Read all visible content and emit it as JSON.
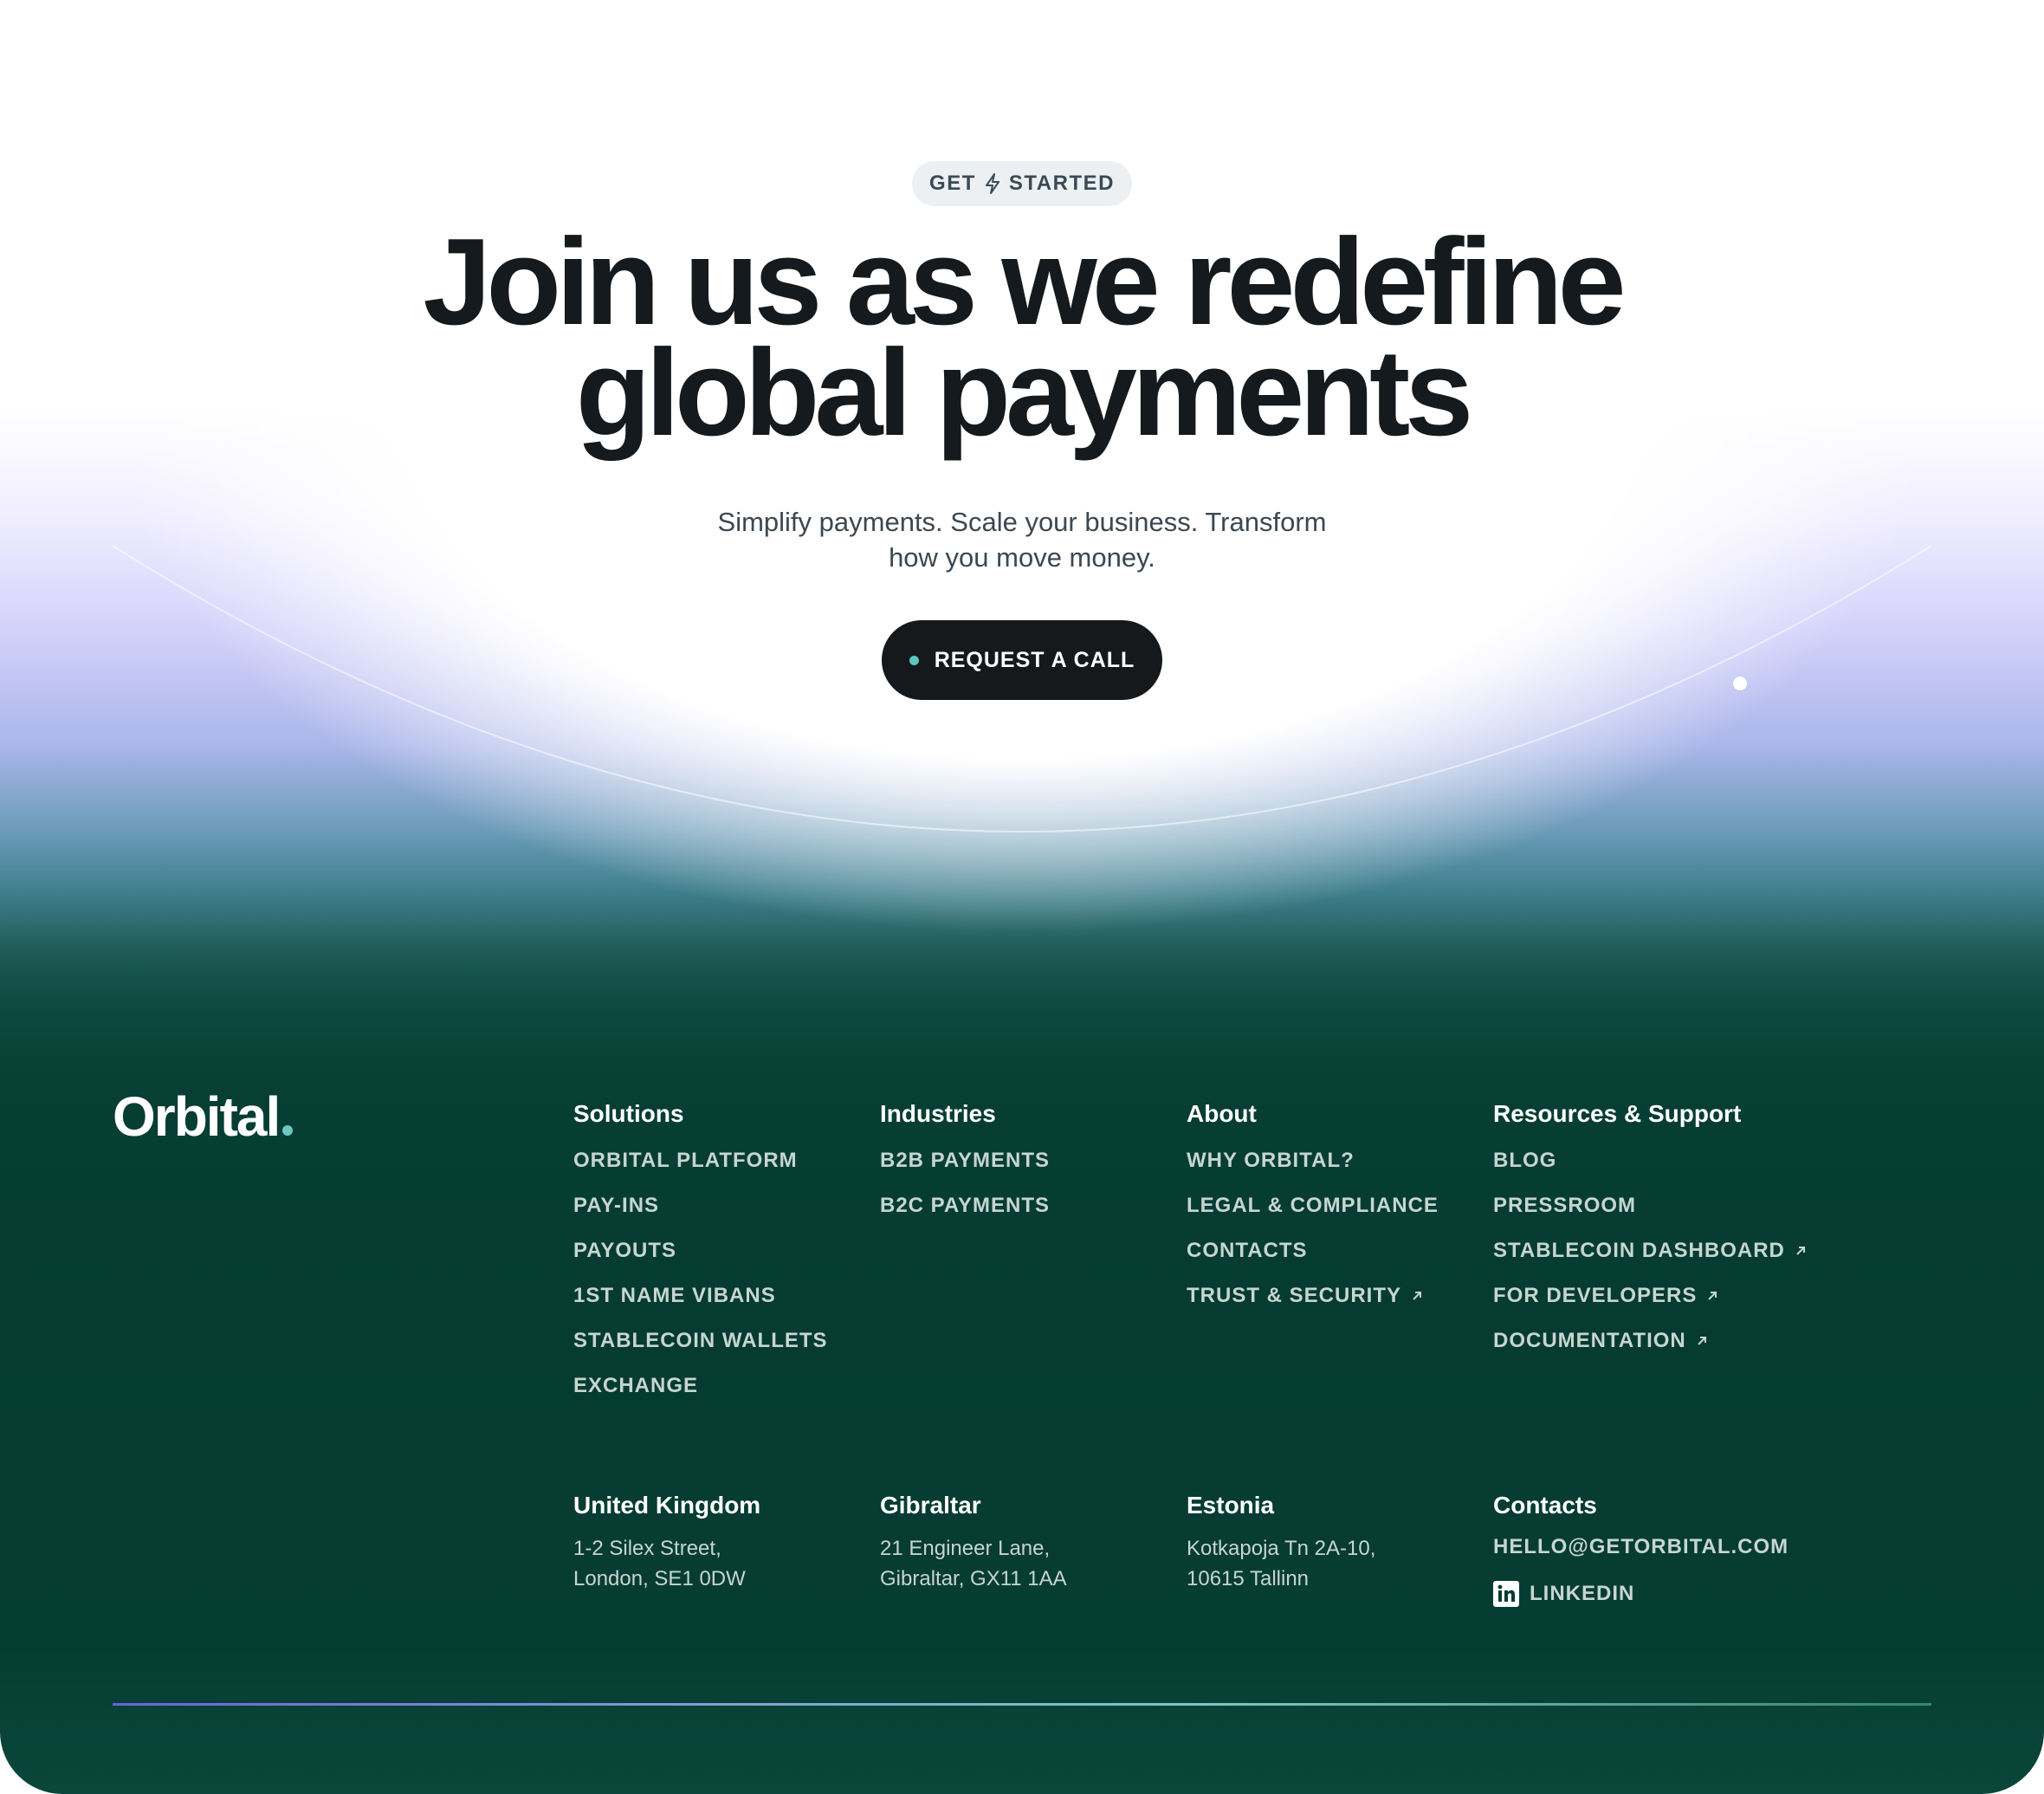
{
  "hero": {
    "badge_left": "GET",
    "badge_right": "STARTED",
    "headline_line1": "Join us as we redefine",
    "headline_line2": "global payments",
    "subtitle_line1": "Simplify payments. Scale your business. Transform",
    "subtitle_line2": "how you move money.",
    "cta_label": "REQUEST A CALL"
  },
  "brand": {
    "name": "Orbital",
    "dot_color": "#6fc7c2"
  },
  "footer": {
    "columns": [
      {
        "title": "Solutions",
        "links": [
          {
            "label": "ORBITAL PLATFORM",
            "external": false
          },
          {
            "label": "PAY-INS",
            "external": false
          },
          {
            "label": "PAYOUTS",
            "external": false
          },
          {
            "label": "1ST NAME VIBANS",
            "external": false
          },
          {
            "label": "STABLECOIN WALLETS",
            "external": false
          },
          {
            "label": "EXCHANGE",
            "external": false
          }
        ]
      },
      {
        "title": "Industries",
        "links": [
          {
            "label": "B2B PAYMENTS",
            "external": false
          },
          {
            "label": "B2C PAYMENTS",
            "external": false
          }
        ]
      },
      {
        "title": "About",
        "links": [
          {
            "label": "WHY ORBITAL?",
            "external": false
          },
          {
            "label": "LEGAL & COMPLIANCE",
            "external": false
          },
          {
            "label": "CONTACTS",
            "external": false
          },
          {
            "label": "TRUST & SECURITY",
            "external": true
          }
        ]
      },
      {
        "title": "Resources & Support",
        "links": [
          {
            "label": "BLOG",
            "external": false
          },
          {
            "label": "PRESSROOM",
            "external": false
          },
          {
            "label": "STABLECOIN DASHBOARD",
            "external": true
          },
          {
            "label": "FOR DEVELOPERS",
            "external": true
          },
          {
            "label": "DOCUMENTATION",
            "external": true
          }
        ]
      }
    ],
    "locations": [
      {
        "title": "United Kingdom",
        "line1": "1-2 Silex Street,",
        "line2": "London, SE1 0DW"
      },
      {
        "title": "Gibraltar",
        "line1": "21 Engineer Lane,",
        "line2": "Gibraltar, GX11 1AA"
      },
      {
        "title": "Estonia",
        "line1": "Kotkapoja Tn 2A-10,",
        "line2": "10615 Tallinn"
      }
    ],
    "contacts": {
      "title": "Contacts",
      "email": "HELLO@GETORBITAL.COM",
      "linkedin": "LINKEDIN"
    }
  },
  "colors": {
    "dark_green": "#053b31",
    "headline": "#141a1d",
    "cta_bg": "#15191c",
    "accent_teal": "#5cc6c0",
    "link_text": "#c7d5d1"
  }
}
